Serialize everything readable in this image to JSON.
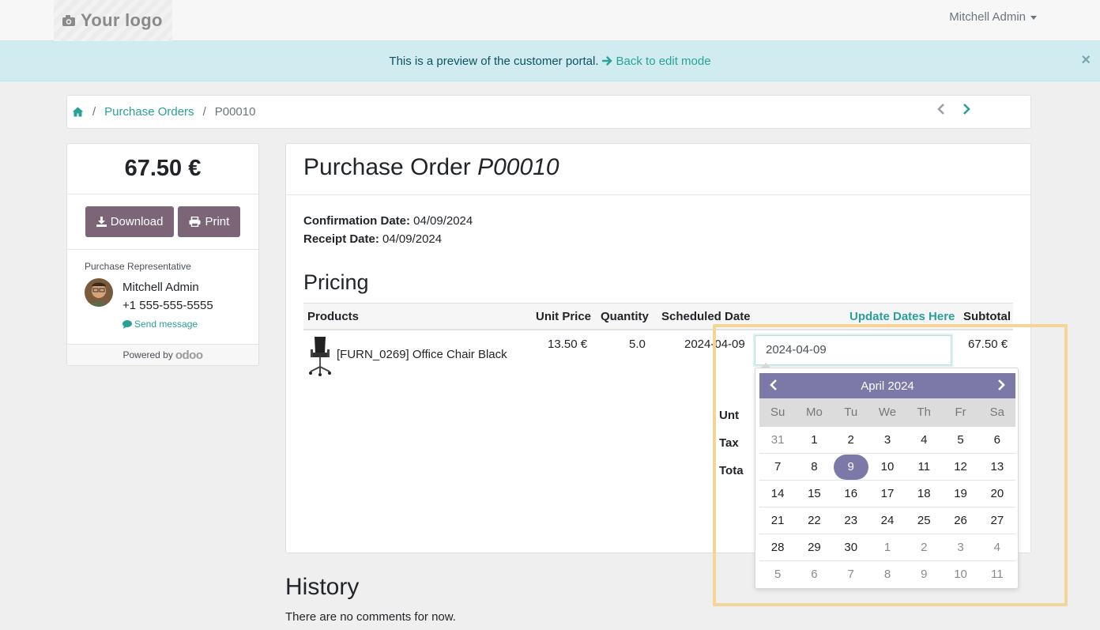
{
  "navbar": {
    "logo_text": "Your logo",
    "user_name": "Mitchell Admin"
  },
  "banner": {
    "text": "This is a preview of the customer portal.",
    "link": "Back to edit mode",
    "close": "×"
  },
  "breadcrumb": {
    "items": [
      "Purchase Orders",
      "P00010"
    ],
    "separator": "/"
  },
  "sidebar": {
    "amount": "67.50 €",
    "download_label": "Download",
    "print_label": "Print",
    "rep_title": "Purchase Representative",
    "rep_name": "Mitchell Admin",
    "rep_phone": "+1 555-555-5555",
    "send_message": "Send message",
    "powered_by": "Powered by",
    "odoo": "odoo"
  },
  "order": {
    "title": "Purchase Order",
    "number": "P00010",
    "confirmation_label": "Confirmation Date:",
    "confirmation_value": "04/09/2024",
    "receipt_label": "Receipt Date:",
    "receipt_value": "04/09/2024",
    "pricing_title": "Pricing",
    "columns": {
      "products": "Products",
      "unit_price": "Unit Price",
      "quantity": "Quantity",
      "scheduled": "Scheduled Date",
      "update": "Update Dates Here",
      "subtotal": "Subtotal"
    },
    "lines": [
      {
        "product": "[FURN_0269] Office Chair Black",
        "unit_price": "13.50 €",
        "quantity": "5.0",
        "scheduled": "2024-04-09",
        "subtotal": "67.50 €"
      }
    ],
    "totals_labels": [
      "Unt",
      "Tax",
      "Tota"
    ]
  },
  "datepicker": {
    "input_value": "2024-04-09",
    "month_label": "April 2024",
    "weekdays": [
      "Su",
      "Mo",
      "Tu",
      "We",
      "Th",
      "Fr",
      "Sa"
    ],
    "weeks": [
      [
        "31",
        "1",
        "2",
        "3",
        "4",
        "5",
        "6"
      ],
      [
        "7",
        "8",
        "9",
        "10",
        "11",
        "12",
        "13"
      ],
      [
        "14",
        "15",
        "16",
        "17",
        "18",
        "19",
        "20"
      ],
      [
        "21",
        "22",
        "23",
        "24",
        "25",
        "26",
        "27"
      ],
      [
        "28",
        "29",
        "30",
        "1",
        "2",
        "3",
        "4"
      ],
      [
        "5",
        "6",
        "7",
        "8",
        "9",
        "10",
        "11"
      ]
    ],
    "selected_day": "9",
    "accent_color": "#7c79a8"
  },
  "history": {
    "title": "History",
    "empty_text": "There are no comments for now."
  },
  "colors": {
    "link": "#2aa198",
    "button": "#7c6577",
    "banner_bg": "#d1ecf1",
    "highlight": "#f4d497"
  }
}
